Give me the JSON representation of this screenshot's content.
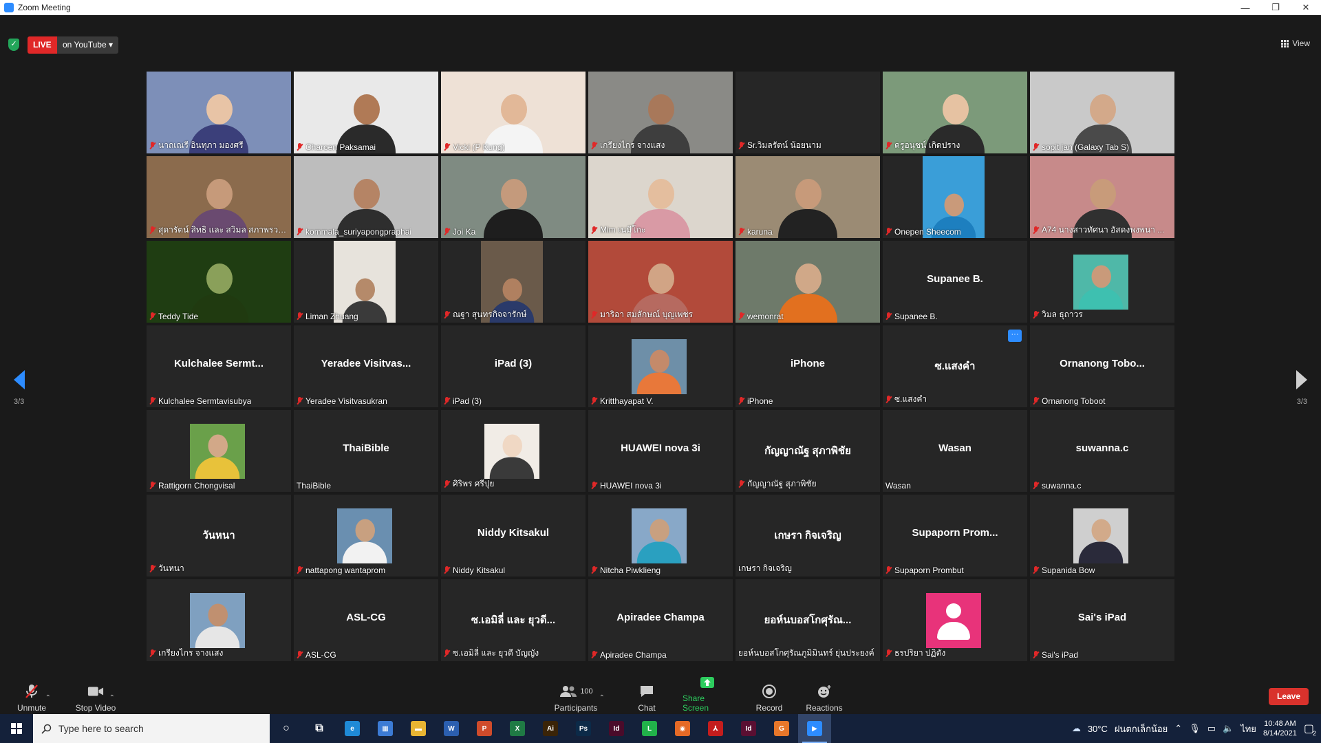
{
  "window": {
    "title": "Zoom Meeting",
    "minimize": "—",
    "restore": "❐",
    "close": "✕"
  },
  "topbar": {
    "live_label": "LIVE",
    "live_destination": "on YouTube ▾",
    "view_label": "View"
  },
  "pager": {
    "left_page": "3/3",
    "right_page": "3/3"
  },
  "colors": {
    "accent": "#2d8cff",
    "live_red": "#e02828",
    "leave_red": "#d9322c",
    "share_green": "#2dcc5e",
    "muted_red": "#e02828"
  },
  "tiles": [
    {
      "label": "นาถเณรี อินทุภา มองศรี",
      "muted": true,
      "kind": "video",
      "bg": "#7d8fb8",
      "skin": "#e8c4a6",
      "cloth": "#3b3f7a"
    },
    {
      "label": "Charoen Paksamai",
      "muted": true,
      "kind": "video",
      "bg": "#e9e9e9",
      "skin": "#b07a56",
      "cloth": "#2a2a2a"
    },
    {
      "label": "Vicki (P Kung)",
      "muted": true,
      "kind": "video",
      "bg": "#eee1d6",
      "skin": "#e2b898",
      "cloth": "#f4f4f4"
    },
    {
      "label": "เกรียงไกร จางแสง",
      "muted": true,
      "kind": "video",
      "bg": "#8a8a86",
      "skin": "#a8785a",
      "cloth": "#3e3e3e"
    },
    {
      "label": "Sr.วิมลรัตน์ น้อยนาม",
      "muted": true,
      "kind": "blank"
    },
    {
      "label": "ครูอนุชน์ เกิดปราง",
      "muted": true,
      "kind": "video",
      "bg": "#7c9a7a",
      "skin": "#e6c2a2",
      "cloth": "#2a2a2a"
    },
    {
      "label": "sopit jan (Galaxy Tab S)",
      "muted": true,
      "kind": "video",
      "bg": "#c9c9c9",
      "skin": "#d3a98a",
      "cloth": "#4a4a4a"
    },
    {
      "label": "สุดารัตน์ สิทธิ และ สวิมล สภาพรวดี...",
      "muted": true,
      "kind": "video",
      "bg": "#8b6b4d",
      "skin": "#c69a7a",
      "cloth": "#6a4a70"
    },
    {
      "label": "kommala_suriyapongpraphai",
      "muted": true,
      "kind": "video",
      "bg": "#bdbdbd",
      "skin": "#b58465",
      "cloth": "#2e2e2e"
    },
    {
      "label": "Joi Ka",
      "muted": true,
      "kind": "video",
      "bg": "#7f8b82",
      "skin": "#c49a7c",
      "cloth": "#1e1e1e"
    },
    {
      "label": "Mim  เนมีโกะ",
      "muted": true,
      "kind": "video",
      "bg": "#dcd6cd",
      "skin": "#e4be9e",
      "cloth": "#d99aa5"
    },
    {
      "label": "karuna",
      "muted": true,
      "kind": "video",
      "bg": "#9b8b74",
      "skin": "#c79a7a",
      "cloth": "#222222"
    },
    {
      "label": "Onepen Sheecom",
      "muted": true,
      "kind": "portrait",
      "bg": "#3a9ed8",
      "skin": "#c99a7a",
      "cloth": "#1d7fbf"
    },
    {
      "label": "A74  นางสาวทัศนา  อัสดงพงพนา ...",
      "muted": true,
      "kind": "video",
      "bg": "#c78a8a",
      "skin": "#c89b7a",
      "cloth": "#303030"
    },
    {
      "label": "Teddy Tide",
      "muted": true,
      "kind": "video",
      "bg": "#1f3d12",
      "skin": "#8aa05a",
      "cloth": "#203a10"
    },
    {
      "label": "Liman Zhuang",
      "muted": true,
      "kind": "portrait",
      "bg": "#e7e3dc",
      "skin": "#b58a6a",
      "cloth": "#3a3a3a"
    },
    {
      "label": "ณฐา สุนทรกิจจารักษ์",
      "muted": true,
      "kind": "portrait",
      "bg": "#6a5a4a",
      "skin": "#b08060",
      "cloth": "#2a3a6a"
    },
    {
      "label": "มาริอา สมลักษณ์  บุญเพชร",
      "muted": true,
      "kind": "video",
      "bg": "#b24a3a",
      "skin": "#d1a485",
      "cloth": "#b66a60"
    },
    {
      "label": "wemonrat",
      "muted": true,
      "kind": "video",
      "bg": "#6e7a6a",
      "skin": "#d0a888",
      "cloth": "#e2701f"
    },
    {
      "label": "Supanee B.",
      "muted": true,
      "kind": "name",
      "big": "Supanee B."
    },
    {
      "label": "วิมล ธุถาวร",
      "muted": true,
      "kind": "thumb",
      "bg": "#4fb8a8",
      "skin": "#c99a7a",
      "cloth": "#3ec0b0"
    },
    {
      "label": "Kulchalee Sermtavisubya",
      "muted": true,
      "kind": "name",
      "big": "Kulchalee  Sermt..."
    },
    {
      "label": "Yeradee Visitvasukran",
      "muted": true,
      "kind": "name",
      "big": "Yeradee  Visitvas..."
    },
    {
      "label": "iPad (3)",
      "muted": true,
      "kind": "name",
      "big": "iPad (3)"
    },
    {
      "label": "Kritthayapat V.",
      "muted": true,
      "kind": "thumb",
      "bg": "#6e8fa8",
      "skin": "#c48a6a",
      "cloth": "#e8783a"
    },
    {
      "label": "iPhone",
      "muted": true,
      "kind": "name",
      "big": "iPhone"
    },
    {
      "label": "ซ.แสงคำ",
      "muted": true,
      "kind": "name",
      "big": "ซ.แสงคำ",
      "more": "···"
    },
    {
      "label": "Ornanong  Toboot",
      "muted": true,
      "kind": "name",
      "big": "Ornanong   Tobo..."
    },
    {
      "label": "Rattigorn Chongvisal",
      "muted": true,
      "kind": "thumb",
      "bg": "#6aa04a",
      "skin": "#d2a888",
      "cloth": "#e8c23a"
    },
    {
      "label": "ThaiBible",
      "muted": false,
      "kind": "name",
      "big": "ThaiBible"
    },
    {
      "label": "ศิริพร ศรีปุย",
      "muted": true,
      "kind": "thumb",
      "bg": "#f1ece6",
      "skin": "#f0d8c4",
      "cloth": "#3a3a3a"
    },
    {
      "label": "HUAWEI nova 3i",
      "muted": true,
      "kind": "name",
      "big": "HUAWEI nova 3i"
    },
    {
      "label": "กัญญาณัฐ สุภาพิชัย",
      "muted": true,
      "kind": "name",
      "big": "กัญญาณัฐ สุภาพิชัย"
    },
    {
      "label": "Wasan",
      "muted": false,
      "kind": "name",
      "big": "Wasan"
    },
    {
      "label": "suwanna.c",
      "muted": true,
      "kind": "name",
      "big": "suwanna.c"
    },
    {
      "label": "วันหนา",
      "muted": true,
      "kind": "name",
      "big": "วันหนา"
    },
    {
      "label": "nattapong wantaprom",
      "muted": true,
      "kind": "thumb",
      "bg": "#6a8fb0",
      "skin": "#c8a080",
      "cloth": "#f2f2f2"
    },
    {
      "label": "Niddy Kitsakul",
      "muted": true,
      "kind": "name",
      "big": "Niddy Kitsakul"
    },
    {
      "label": "Nitcha Piwklieng",
      "muted": true,
      "kind": "thumb",
      "bg": "#88a8c8",
      "skin": "#c8a080",
      "cloth": "#2aa0c0"
    },
    {
      "label": "เกษรา  กิจเจริญ",
      "muted": false,
      "kind": "name",
      "big": "เกษรา  กิจเจริญ"
    },
    {
      "label": "Supaporn Prombut",
      "muted": true,
      "kind": "name",
      "big": "Supaporn  Prom..."
    },
    {
      "label": "Supanida Bow",
      "muted": true,
      "kind": "thumb",
      "bg": "#cfcfcf",
      "skin": "#d2aa8a",
      "cloth": "#2a2a3a"
    },
    {
      "label": "เกรียงไกร จางแสง",
      "muted": true,
      "kind": "thumb",
      "bg": "#7fa0c0",
      "skin": "#c09070",
      "cloth": "#e6e6e6"
    },
    {
      "label": "ASL-CG",
      "muted": true,
      "kind": "name",
      "big": "ASL-CG"
    },
    {
      "label": "ซ.เอมิลี่ และ ยุวดี บัญญัง",
      "muted": true,
      "kind": "name",
      "big": "ซ.เอมิลี่ และ ยุวดี..."
    },
    {
      "label": "Apiradee Champa",
      "muted": true,
      "kind": "name",
      "big": "Apiradee Champa"
    },
    {
      "label": "ยอห์นบอสโกศุรัณภูมิมินทร์ ยุ่นประยงค์",
      "muted": false,
      "kind": "name",
      "big": "ยอห์นบอสโกศุรัณ..."
    },
    {
      "label": "ธรปริยา ปฏิตัง",
      "muted": true,
      "kind": "avatar"
    },
    {
      "label": "Sai's iPad",
      "muted": true,
      "kind": "name",
      "big": "Sai's iPad"
    }
  ],
  "toolbar": {
    "unmute": "Unmute",
    "stop_video": "Stop Video",
    "participants": "Participants",
    "participants_count": "100",
    "chat": "Chat",
    "share_screen": "Share Screen",
    "record": "Record",
    "reactions": "Reactions",
    "leave": "Leave"
  },
  "taskbar": {
    "search_placeholder": "Type here to search",
    "apps": [
      {
        "name": "cortana-icon",
        "glyph": "○",
        "color": "transparent"
      },
      {
        "name": "task-view-icon",
        "glyph": "⧉",
        "color": "transparent"
      },
      {
        "name": "edge-icon",
        "glyph": "e",
        "color": "#1f8ad6"
      },
      {
        "name": "calculator-icon",
        "glyph": "▦",
        "color": "#3c7bd4"
      },
      {
        "name": "file-explorer-icon",
        "glyph": "▬",
        "color": "#e8b533"
      },
      {
        "name": "word-icon",
        "glyph": "W",
        "color": "#2b5fb0"
      },
      {
        "name": "powerpoint-icon",
        "glyph": "P",
        "color": "#cf4b2b"
      },
      {
        "name": "excel-icon",
        "glyph": "X",
        "color": "#1f7a44"
      },
      {
        "name": "illustrator-icon",
        "glyph": "Ai",
        "color": "#3a2408"
      },
      {
        "name": "photoshop-icon",
        "glyph": "Ps",
        "color": "#0c2a48"
      },
      {
        "name": "indesign-icon",
        "glyph": "Id",
        "color": "#4a0b2a"
      },
      {
        "name": "line-icon",
        "glyph": "L",
        "color": "#21b24a"
      },
      {
        "name": "firefox-icon",
        "glyph": "◉",
        "color": "#e56a26"
      },
      {
        "name": "acrobat-icon",
        "glyph": "⅄",
        "color": "#c41d1d"
      },
      {
        "name": "indesign-2-icon",
        "glyph": "Id",
        "color": "#5a0f32"
      },
      {
        "name": "gfonts-icon",
        "glyph": "G",
        "color": "#e7772a"
      },
      {
        "name": "zoom-icon",
        "glyph": "▶",
        "color": "#2d8cff",
        "active": true
      }
    ],
    "weather": "30°C",
    "weather_text": "ฝนตกเล็กน้อย",
    "lang": "ไทย",
    "time": "10:48 AM",
    "date": "8/14/2021",
    "notifications": "2"
  }
}
